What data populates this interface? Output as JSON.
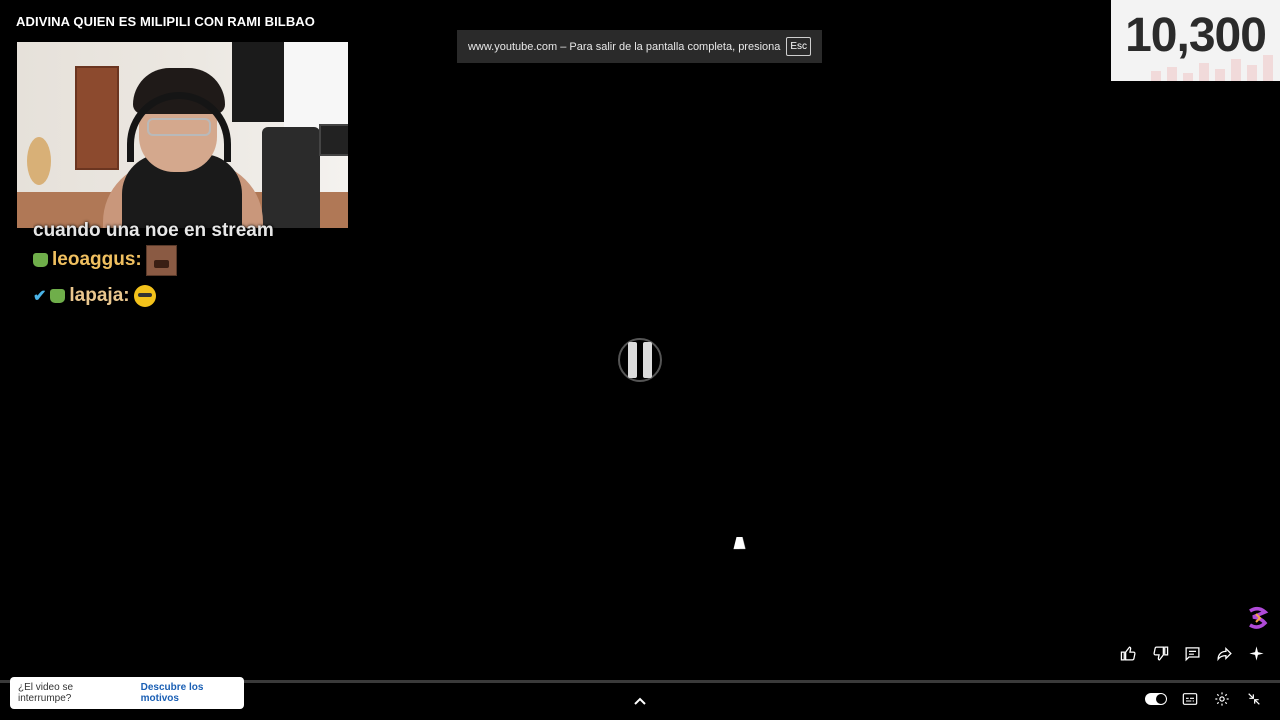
{
  "video": {
    "title": "ADIVINA QUIEN ES MILIPILI CON RAMI BILBAO"
  },
  "fullscreen_notice": {
    "message": "www.youtube.com – Para salir de la pantalla completa, presiona",
    "key": "Esc"
  },
  "counter": {
    "value": "10,300"
  },
  "chat": {
    "partial_line": "cuando una noe en stream",
    "messages": [
      {
        "username": "leoaggus:",
        "badges": [
          "bag-badge"
        ],
        "emote": "face-emote"
      },
      {
        "username": "lapaja:",
        "badges": [
          "sword-badge",
          "bag-badge"
        ],
        "emote": "yellow-emote"
      }
    ]
  },
  "player": {
    "state": "paused"
  },
  "interrupt": {
    "question": "¿El video se interrumpe?",
    "link": "Descubre los motivos"
  },
  "icons": {
    "like": "thumb-up-icon",
    "dislike": "thumb-down-icon",
    "comments": "comment-icon",
    "share": "share-icon",
    "ask": "sparkle-icon",
    "subtitles": "subtitles-icon",
    "settings": "gear-icon",
    "exit_fullscreen": "exit-fullscreen-icon"
  }
}
